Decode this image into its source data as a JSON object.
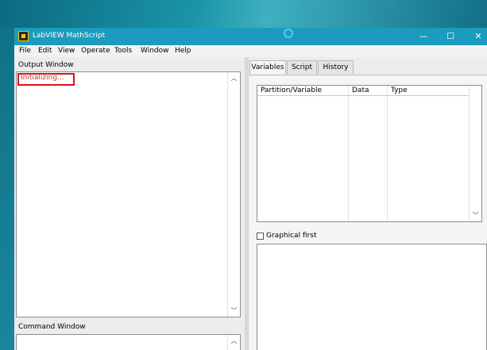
{
  "window": {
    "title": "LabVIEW MathScript",
    "minimize": "—",
    "maximize": "☐",
    "close": "✕"
  },
  "menu": [
    "File",
    "Edit",
    "View",
    "Operate",
    "Tools",
    "Window",
    "Help"
  ],
  "output_window": {
    "label": "Output Window",
    "status": "Initializing..."
  },
  "command_window": {
    "label": "Command Window"
  },
  "tabs": [
    "Variables",
    "Script",
    "History"
  ],
  "variables_table": {
    "columns": [
      "Partition/Variable",
      "Data",
      "Type"
    ]
  },
  "graphical_first": {
    "label": "Graphical first",
    "checked": false
  },
  "colors": {
    "titlebar": "#1b9bbd",
    "highlight": "#e0101a",
    "status_text": "#c0392b"
  }
}
